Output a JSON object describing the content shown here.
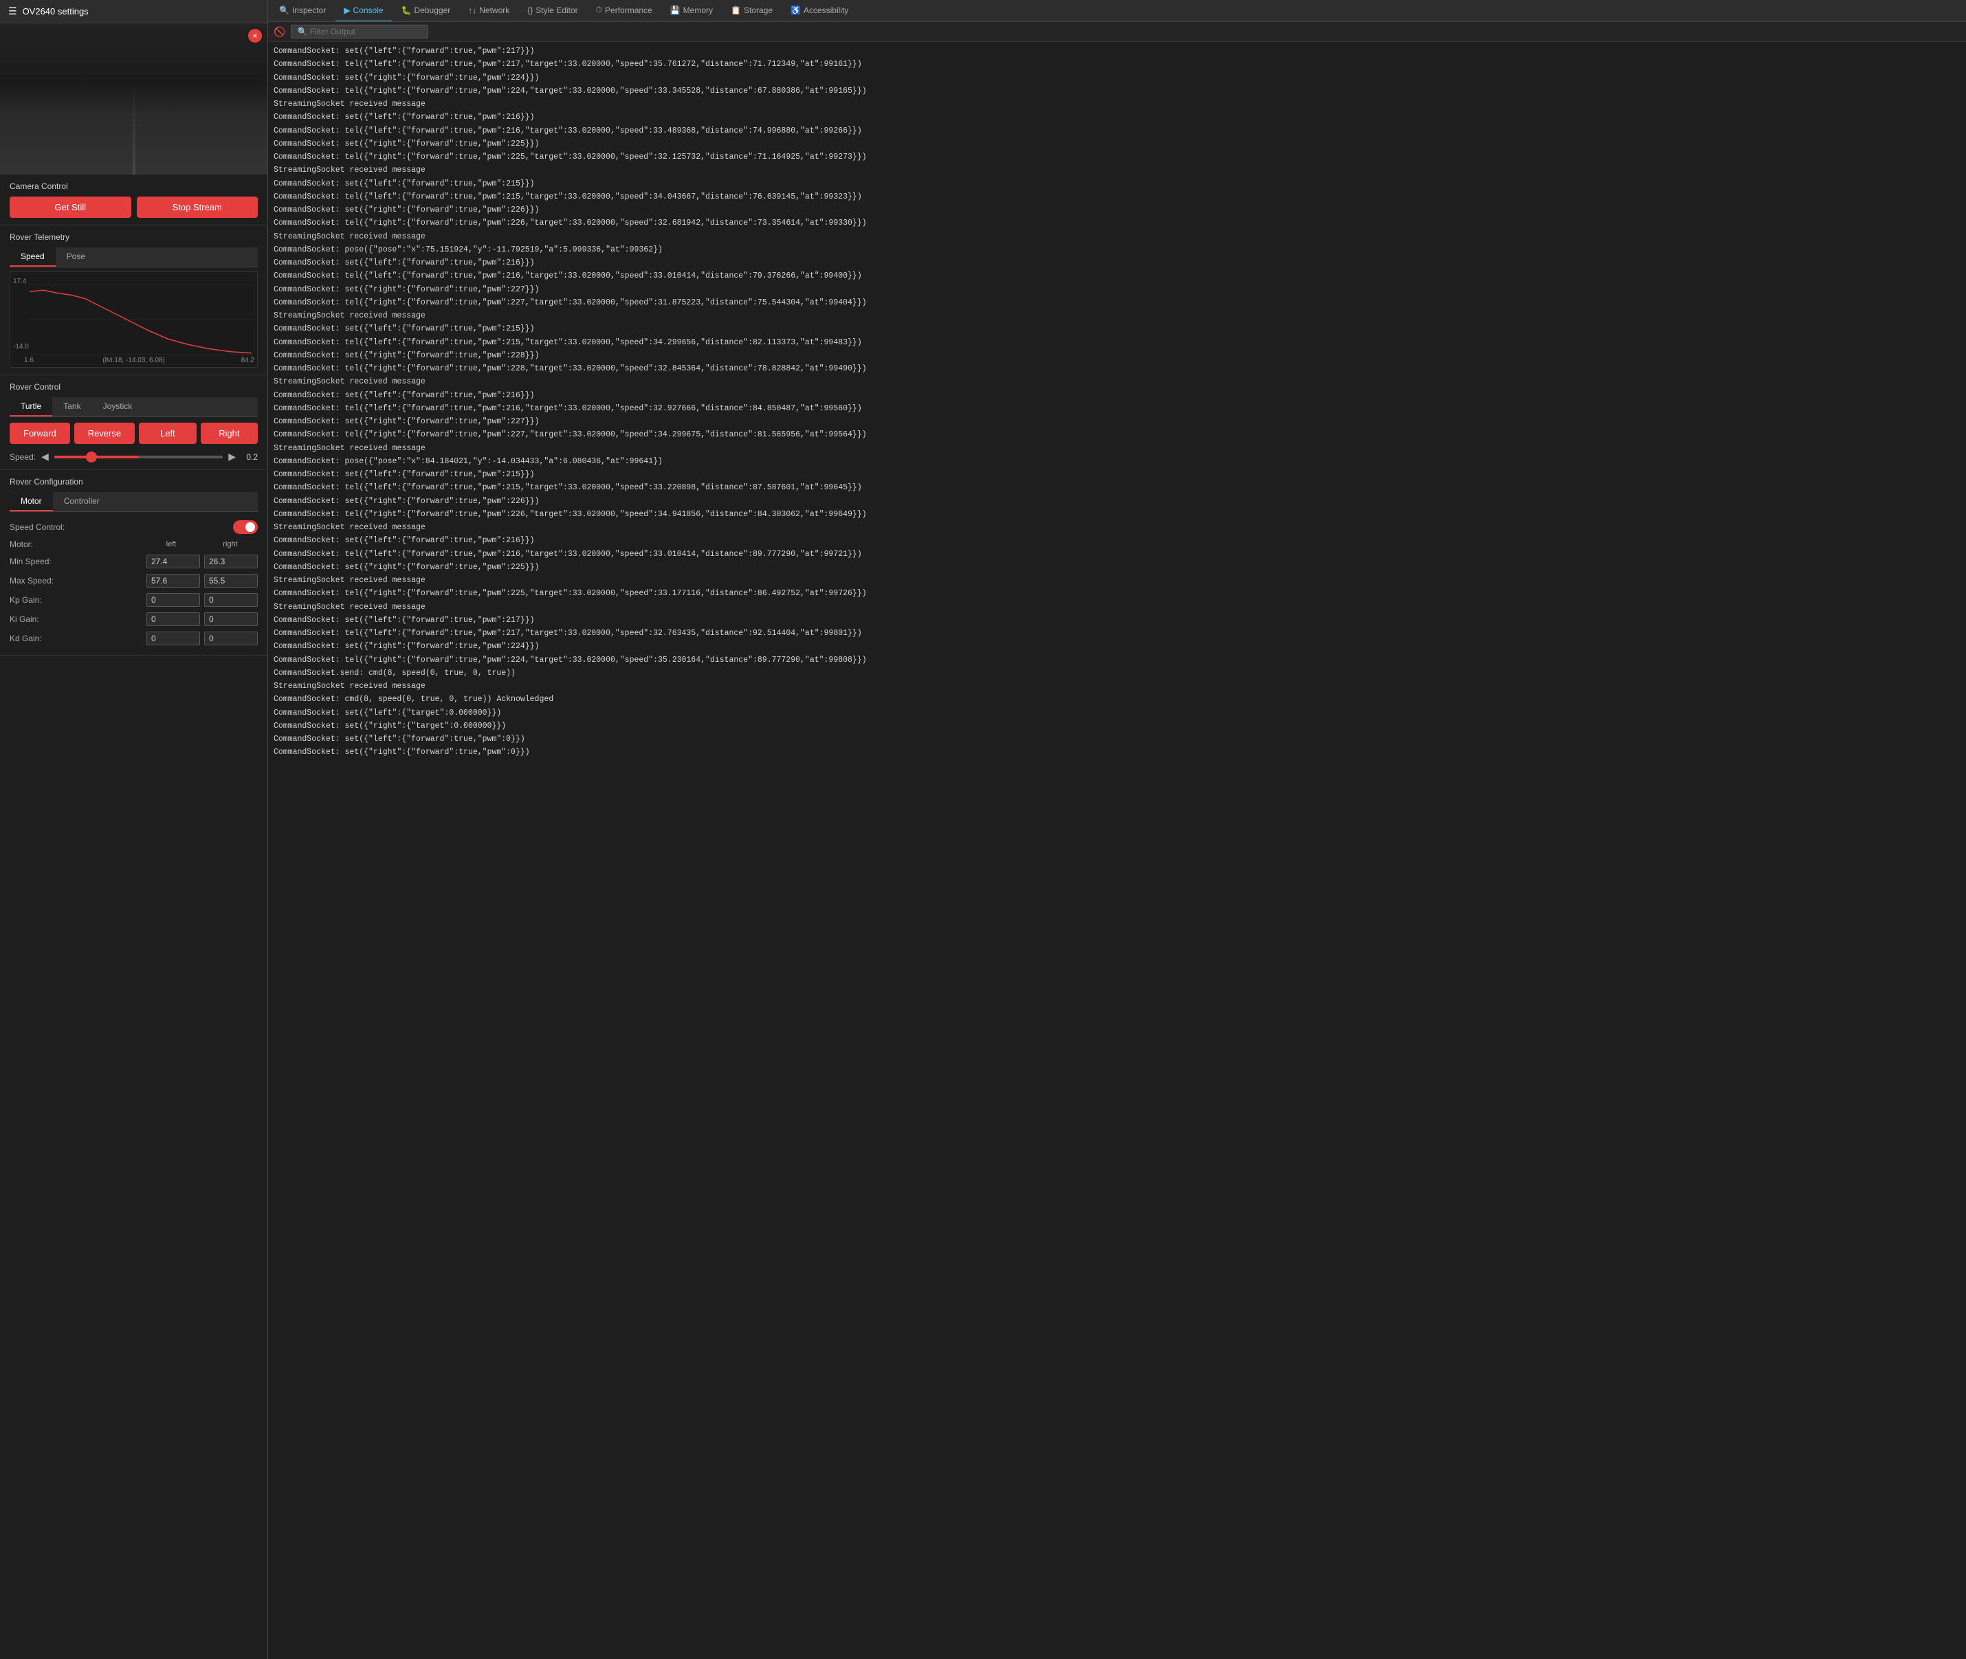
{
  "app": {
    "title": "OV2640 settings"
  },
  "camera": {
    "close_label": "×"
  },
  "camera_control": {
    "section_title": "Camera Control",
    "get_still_label": "Get Still",
    "stop_stream_label": "Stop Stream"
  },
  "rover_telemetry": {
    "section_title": "Rover Telemetry",
    "tab_speed": "Speed",
    "tab_pose": "Pose",
    "chart": {
      "y_top": "17.4",
      "y_bottom": "-14.0",
      "x_left": "1.6",
      "x_label_mid": "(84.18, -14.03, 6.08)",
      "x_right": "84.2"
    }
  },
  "rover_control": {
    "section_title": "Rover Control",
    "tab_turtle": "Turtle",
    "tab_tank": "Tank",
    "tab_joystick": "Joystick",
    "forward_label": "Forward",
    "reverse_label": "Reverse",
    "left_label": "Left",
    "right_label": "Right",
    "speed_label": "Speed:",
    "speed_value": "0.2"
  },
  "rover_config": {
    "section_title": "Rover Configuration",
    "tab_motor": "Motor",
    "tab_controller": "Controller",
    "speed_control_label": "Speed Control:",
    "motor_label": "Motor:",
    "left_col": "left",
    "right_col": "right",
    "min_speed_label": "Min Speed:",
    "min_speed_left": "27.4",
    "min_speed_right": "26.3",
    "max_speed_label": "Max Speed:",
    "max_speed_left": "57.6",
    "max_speed_right": "55.5",
    "kp_gain_label": "Kp Gain:",
    "kp_gain_left": "0",
    "kp_gain_right": "0",
    "ki_gain_label": "Ki Gain:",
    "ki_gain_left": "0",
    "ki_gain_right": "0",
    "kd_gain_label": "Kd Gain:",
    "kd_gain_left": "0",
    "kd_gain_right": "0"
  },
  "devtools": {
    "tabs": [
      {
        "id": "inspector",
        "label": "Inspector",
        "icon": "🔍"
      },
      {
        "id": "console",
        "label": "Console",
        "icon": "▶",
        "active": true
      },
      {
        "id": "debugger",
        "label": "Debugger",
        "icon": "🐛"
      },
      {
        "id": "network",
        "label": "Network",
        "icon": "↑↓"
      },
      {
        "id": "style-editor",
        "label": "Style Editor",
        "icon": "{}"
      },
      {
        "id": "performance",
        "label": "Performance",
        "icon": "🎯"
      },
      {
        "id": "memory",
        "label": "Memory",
        "icon": "💾"
      },
      {
        "id": "storage",
        "label": "Storage",
        "icon": "📋"
      },
      {
        "id": "accessibility",
        "label": "Accessibility",
        "icon": "♿"
      }
    ],
    "toolbar": {
      "clear_label": "🚫",
      "filter_placeholder": "🔍 Filter Output"
    },
    "console_lines": [
      "CommandSocket: set({\"left\":{\"forward\":true,\"pwm\":217}})",
      "CommandSocket: tel({\"left\":{\"forward\":true,\"pwm\":217,\"target\":33.020000,\"speed\":35.761272,\"distance\":71.712349,\"at\":99161}})",
      "CommandSocket: set({\"right\":{\"forward\":true,\"pwm\":224}})",
      "CommandSocket: tel({\"right\":{\"forward\":true,\"pwm\":224,\"target\":33.020000,\"speed\":33.345528,\"distance\":67.880386,\"at\":99165}})",
      "StreamingSocket received message",
      "CommandSocket: set({\"left\":{\"forward\":true,\"pwm\":216}})",
      "CommandSocket: tel({\"left\":{\"forward\":true,\"pwm\":216,\"target\":33.020000,\"speed\":33.489368,\"distance\":74.996880,\"at\":99266}})",
      "CommandSocket: set({\"right\":{\"forward\":true,\"pwm\":225}})",
      "CommandSocket: tel({\"right\":{\"forward\":true,\"pwm\":225,\"target\":33.020000,\"speed\":32.125732,\"distance\":71.164925,\"at\":99273}})",
      "StreamingSocket received message",
      "CommandSocket: set({\"left\":{\"forward\":true,\"pwm\":215}})",
      "CommandSocket: tel({\"left\":{\"forward\":true,\"pwm\":215,\"target\":33.020000,\"speed\":34.043667,\"distance\":76.639145,\"at\":99323}})",
      "CommandSocket: set({\"right\":{\"forward\":true,\"pwm\":226}})",
      "CommandSocket: tel({\"right\":{\"forward\":true,\"pwm\":226,\"target\":33.020000,\"speed\":32.681942,\"distance\":73.354614,\"at\":99330}})",
      "StreamingSocket received message",
      "CommandSocket: pose({\"pose\":\"x\":75.151924,\"y\":-11.792519,\"a\":5.999336,\"at\":99362})",
      "CommandSocket: set({\"left\":{\"forward\":true,\"pwm\":216}})",
      "CommandSocket: tel({\"left\":{\"forward\":true,\"pwm\":216,\"target\":33.020000,\"speed\":33.010414,\"distance\":79.376266,\"at\":99400}})",
      "CommandSocket: set({\"right\":{\"forward\":true,\"pwm\":227}})",
      "CommandSocket: tel({\"right\":{\"forward\":true,\"pwm\":227,\"target\":33.020000,\"speed\":31.875223,\"distance\":75.544304,\"at\":99404}})",
      "StreamingSocket received message",
      "CommandSocket: set({\"left\":{\"forward\":true,\"pwm\":215}})",
      "CommandSocket: tel({\"left\":{\"forward\":true,\"pwm\":215,\"target\":33.020000,\"speed\":34.299656,\"distance\":82.113373,\"at\":99483}})",
      "CommandSocket: set({\"right\":{\"forward\":true,\"pwm\":228}})",
      "CommandSocket: tel({\"right\":{\"forward\":true,\"pwm\":228,\"target\":33.020000,\"speed\":32.845364,\"distance\":78.828842,\"at\":99490}})",
      "StreamingSocket received message",
      "CommandSocket: set({\"left\":{\"forward\":true,\"pwm\":216}})",
      "CommandSocket: tel({\"left\":{\"forward\":true,\"pwm\":216,\"target\":33.020000,\"speed\":32.927666,\"distance\":84.850487,\"at\":99560}})",
      "CommandSocket: set({\"right\":{\"forward\":true,\"pwm\":227}})",
      "CommandSocket: tel({\"right\":{\"forward\":true,\"pwm\":227,\"target\":33.020000,\"speed\":34.299675,\"distance\":81.565956,\"at\":99564}})",
      "StreamingSocket received message",
      "CommandSocket: pose({\"pose\":\"x\":84.184021,\"y\":-14.034433,\"a\":6.080436,\"at\":99641})",
      "CommandSocket: set({\"left\":{\"forward\":true,\"pwm\":215}})",
      "CommandSocket: tel({\"left\":{\"forward\":true,\"pwm\":215,\"target\":33.020000,\"speed\":33.220898,\"distance\":87.587601,\"at\":99645}})",
      "CommandSocket: set({\"right\":{\"forward\":true,\"pwm\":226}})",
      "CommandSocket: tel({\"right\":{\"forward\":true,\"pwm\":226,\"target\":33.020000,\"speed\":34.941856,\"distance\":84.303062,\"at\":99649}})",
      "StreamingSocket received message",
      "CommandSocket: set({\"left\":{\"forward\":true,\"pwm\":216}})",
      "CommandSocket: tel({\"left\":{\"forward\":true,\"pwm\":216,\"target\":33.020000,\"speed\":33.010414,\"distance\":89.777290,\"at\":99721}})",
      "CommandSocket: set({\"right\":{\"forward\":true,\"pwm\":225}})",
      "StreamingSocket received message",
      "CommandSocket: tel({\"right\":{\"forward\":true,\"pwm\":225,\"target\":33.020000,\"speed\":33.177116,\"distance\":86.492752,\"at\":99726}})",
      "StreamingSocket received message",
      "CommandSocket: set({\"left\":{\"forward\":true,\"pwm\":217}})",
      "CommandSocket: tel({\"left\":{\"forward\":true,\"pwm\":217,\"target\":33.020000,\"speed\":32.763435,\"distance\":92.514404,\"at\":99801}})",
      "CommandSocket: set({\"right\":{\"forward\":true,\"pwm\":224}})",
      "CommandSocket: tel({\"right\":{\"forward\":true,\"pwm\":224,\"target\":33.020000,\"speed\":35.230164,\"distance\":89.777290,\"at\":99808}})",
      "CommandSocket.send: cmd(8, speed(0, true, 0, true))",
      "StreamingSocket received message",
      "CommandSocket: cmd(8, speed(0, true, 0, true)) Acknowledged",
      "CommandSocket: set({\"left\":{\"target\":0.000000}})",
      "CommandSocket: set({\"right\":{\"target\":0.000000}})",
      "CommandSocket: set({\"left\":{\"forward\":true,\"pwm\":0}})",
      "CommandSocket: set({\"right\":{\"forward\":true,\"pwm\":0}})"
    ]
  }
}
